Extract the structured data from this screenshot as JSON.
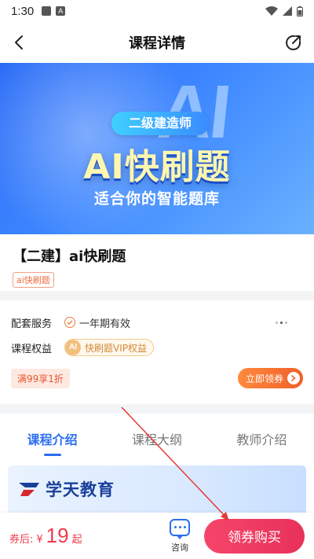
{
  "status_bar": {
    "time": "1:30",
    "colors": {
      "icons": "#555555"
    }
  },
  "header": {
    "title": "课程详情",
    "back_icon": "chevron-left-icon",
    "share_icon": "share-icon"
  },
  "banner": {
    "watermark": "AI",
    "tag": "二级建造师",
    "headline": "AI快刷题",
    "subtitle": "适合你的智能题库",
    "colors": {
      "bg_start": "#2b6cf6",
      "bg_end": "#69b2ff",
      "headline": "#fff7b0"
    }
  },
  "course": {
    "title": "【二建】ai快刷题",
    "badge": "ai快刷题"
  },
  "services": {
    "support_label": "配套服务",
    "support_value": "一年期有效",
    "rights_label": "课程权益",
    "vip_icon_text": "AI",
    "vip_text": "快刷题VIP权益",
    "coupon_tag": "满99享1折",
    "coupon_button": "立即领券",
    "colors": {
      "accent": "#f0602a",
      "vip": "#d28a35"
    }
  },
  "tabs": [
    {
      "label": "课程介绍",
      "active": true
    },
    {
      "label": "课程大纲",
      "active": false
    },
    {
      "label": "教师介绍",
      "active": false
    }
  ],
  "intro": {
    "brand_name": "学天教育"
  },
  "bottom_bar": {
    "price_label": "券后:",
    "currency": "¥",
    "price": "19",
    "price_suffix": "起",
    "consult_label": "咨询",
    "buy_button": "领券购买",
    "colors": {
      "price": "#ef3b4c",
      "buy": "#e8315a",
      "consult": "#2a6ef0"
    }
  }
}
